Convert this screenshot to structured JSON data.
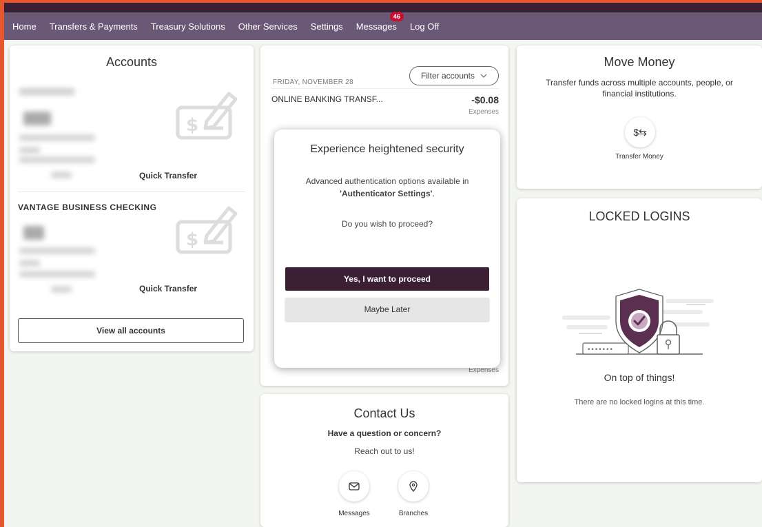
{
  "nav": {
    "items": [
      "Home",
      "Transfers & Payments",
      "Treasury Solutions",
      "Other Services",
      "Settings",
      "Messages",
      "Log Off"
    ],
    "messages_badge": "46"
  },
  "accounts": {
    "title": "Accounts",
    "quick_transfer_label": "Quick Transfer",
    "second_account_name": "VANTAGE BUSINESS CHECKING",
    "view_all_label": "View all accounts"
  },
  "transactions": {
    "filter_label": "Filter accounts",
    "date": "FRIDAY, NOVEMBER 28",
    "first": {
      "desc": "ONLINE BANKING TRANSF...",
      "amount": "-$0.08",
      "category": "Expenses"
    },
    "last_category": "Expenses"
  },
  "modal": {
    "title": "Experience heightened security",
    "text_prefix": "Advanced authentication options available in",
    "text_emph": "'Authenticator Settings'",
    "text_suffix": ".",
    "question": "Do you wish to proceed?",
    "primary_label": "Yes, I want to proceed",
    "secondary_label": "Maybe Later"
  },
  "contact": {
    "title": "Contact Us",
    "subtitle": "Have a question or concern?",
    "subtext": "Reach out to us!",
    "messages_label": "Messages",
    "branches_label": "Branches"
  },
  "move_money": {
    "title": "Move Money",
    "description": "Transfer funds across multiple accounts, people, or financial institutions.",
    "icon_text": "$⇆",
    "transfer_label": "Transfer Money"
  },
  "locked": {
    "title": "LOCKED LOGINS",
    "heading": "On top of things!",
    "message": "There are no locked logins at this time."
  },
  "colors": {
    "nav_bg": "#6b5776",
    "brand_dark": "#3b1f35",
    "frame": "#e8562e",
    "badge": "#c8102e"
  }
}
